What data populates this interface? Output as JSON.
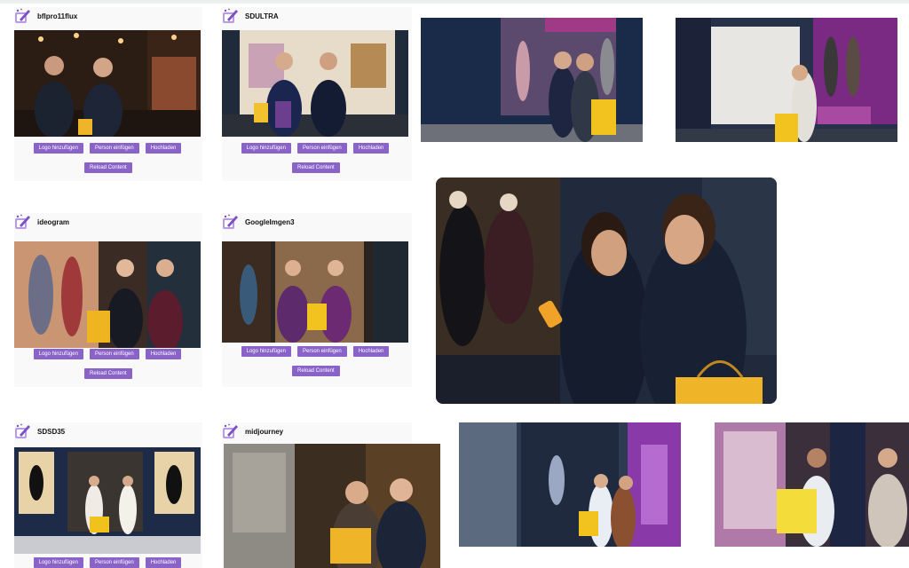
{
  "buttons": {
    "add_logo": "Logo hinzufügen",
    "insert_person": "Person einfügen",
    "upload": "Hochladen",
    "reload": "Reload Content"
  },
  "cards": [
    {
      "title": "bflpro11flux"
    },
    {
      "title": "SDULTRA"
    },
    {
      "title": "ideogram"
    },
    {
      "title": "GoogleImgen3"
    },
    {
      "title": "SDSD35"
    },
    {
      "title": "midjourney"
    }
  ],
  "colors": {
    "button_purple": "#8a63c9",
    "logo_purple": "#7c4fc4",
    "shopping_bag_yellow": "#f0b429",
    "navy": "#1c2538"
  },
  "icons": {
    "card_logo": "edit-pen-icon"
  }
}
